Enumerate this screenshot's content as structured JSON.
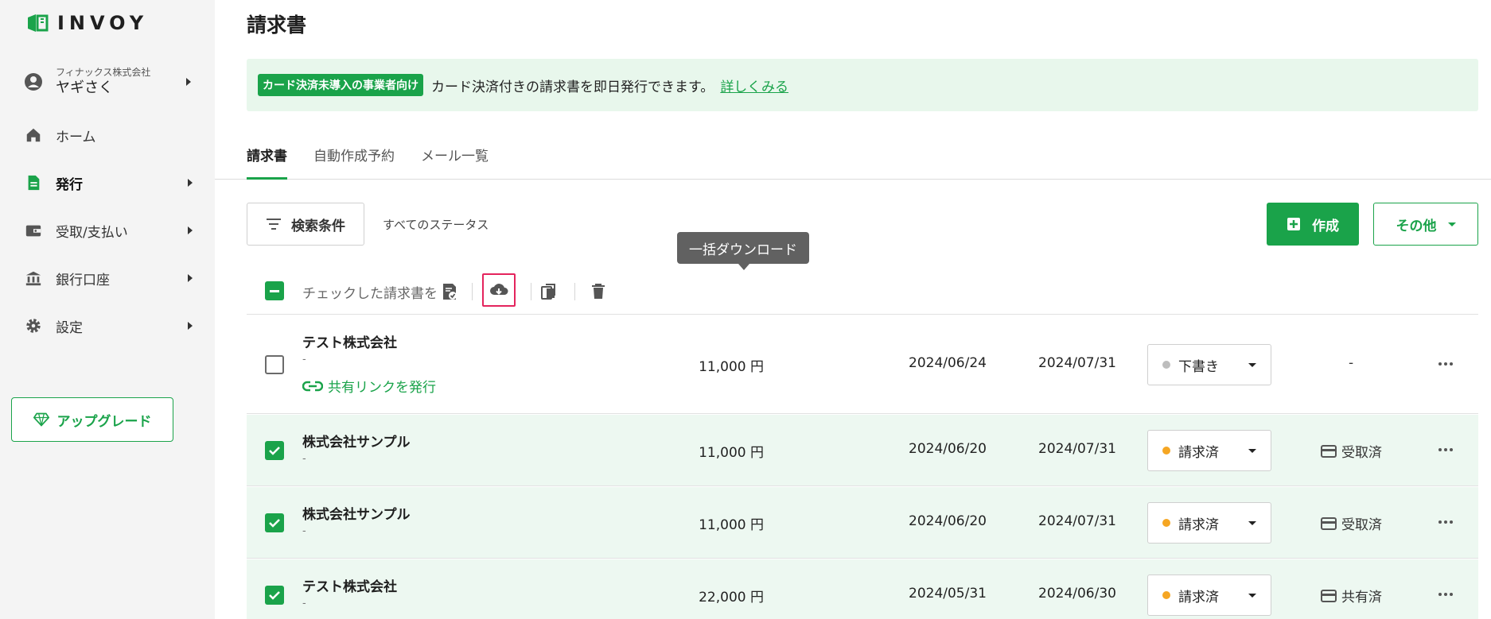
{
  "brand": {
    "name": "INVOY",
    "accent": "#1aa34a"
  },
  "account": {
    "company": "フィナックス株式会社",
    "user": "ヤギさく"
  },
  "nav": [
    {
      "label": "ホーム",
      "icon": "home-icon"
    },
    {
      "label": "発行",
      "icon": "document-icon",
      "active": true
    },
    {
      "label": "受取/支払い",
      "icon": "wallet-icon"
    },
    {
      "label": "銀行口座",
      "icon": "bank-icon"
    },
    {
      "label": "設定",
      "icon": "gear-icon"
    }
  ],
  "upgrade": {
    "label": "アップグレード",
    "icon": "diamond-icon"
  },
  "page": {
    "title": "請求書"
  },
  "banner": {
    "badge": "カード決済未導入の事業者向け",
    "text": "カード決済付きの請求書を即日発行できます。",
    "link": "詳しくみる"
  },
  "tabs": [
    "請求書",
    "自動作成予約",
    "メール一覧"
  ],
  "toolbar": {
    "filter_label": "検索条件",
    "status_filter": "すべてのステータス",
    "create_label": "作成",
    "other_label": "その他"
  },
  "bulk": {
    "label": "チェックした請求書を",
    "tooltip": "一括ダウンロード"
  },
  "rows": [
    {
      "name": "テスト株式会社",
      "sub": "-",
      "share": "共有リンクを発行",
      "amount": "11,000 円",
      "issue_date": "2024/06/24",
      "due_date": "2024/07/31",
      "status": "下書き",
      "status_color": "#bdbdbd",
      "payment": "-",
      "checked": false
    },
    {
      "name": "株式会社サンプル",
      "sub": "-",
      "amount": "11,000 円",
      "issue_date": "2024/06/20",
      "due_date": "2024/07/31",
      "status": "請求済",
      "status_color": "#f5a623",
      "payment": "受取済",
      "checked": true
    },
    {
      "name": "株式会社サンプル",
      "sub": "-",
      "amount": "11,000 円",
      "issue_date": "2024/06/20",
      "due_date": "2024/07/31",
      "status": "請求済",
      "status_color": "#f5a623",
      "payment": "受取済",
      "checked": true
    },
    {
      "name": "テスト株式会社",
      "sub": "-",
      "amount": "22,000 円",
      "issue_date": "2024/05/31",
      "due_date": "2024/06/30",
      "status": "請求済",
      "status_color": "#f5a623",
      "payment": "共有済",
      "checked": true
    }
  ]
}
